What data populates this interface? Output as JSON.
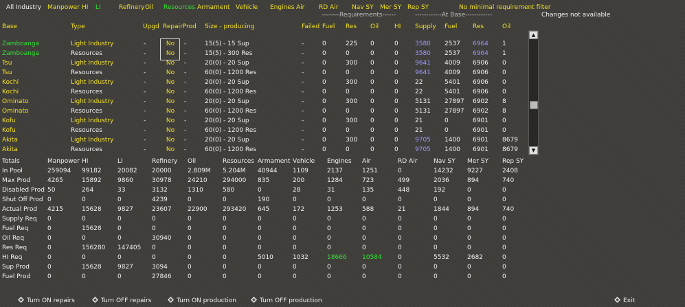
{
  "filters": [
    {
      "label": "All Industry",
      "color": "w"
    },
    {
      "label": "Manpower",
      "color": "y"
    },
    {
      "label": "HI",
      "color": "y"
    },
    {
      "label": "LI",
      "color": "g"
    },
    {
      "label": "Refinery",
      "color": "y"
    },
    {
      "label": "Oil",
      "color": "y"
    },
    {
      "label": "Resources",
      "color": "g"
    },
    {
      "label": "Armament",
      "color": "y"
    },
    {
      "label": "Vehicle",
      "color": "y"
    },
    {
      "label": "Engines",
      "color": "y"
    },
    {
      "label": "Air",
      "color": "y"
    },
    {
      "label": "RD Air",
      "color": "y"
    },
    {
      "label": "Nav SY",
      "color": "y"
    },
    {
      "label": "Mer SY",
      "color": "y"
    },
    {
      "label": "Rep SY",
      "color": "y"
    }
  ],
  "no_min_filter": "No minimal requirement filter",
  "requirements_label": "--------Requirements------",
  "at_base_label": "------------At Base------------",
  "changes_note": "Changes not available",
  "columns": [
    "Base",
    "Type",
    "Upgd",
    "RepairProd",
    "Size - producing",
    "Failed",
    "Fuel",
    "Res",
    "Oil",
    "HI",
    "Supply",
    "Fuel",
    "Res",
    "Oil"
  ],
  "rows": [
    {
      "base": "Zamboanga",
      "type": "Light Industry",
      "upgd": "-",
      "repair": "No",
      "size": "15(5) - 15 Sup",
      "failed": "-",
      "fuel": "0",
      "res": "225",
      "oil": "0",
      "hi": "0",
      "supply": "3580",
      "bfuel": "2537",
      "bres": "6964",
      "boil": "1",
      "bc": "g",
      "sc": "b",
      "rc": "b",
      "rowc": "y"
    },
    {
      "base": "Zamboanga",
      "type": "Resources",
      "upgd": "-",
      "repair": "No",
      "size": "15(5) - 300 Res",
      "failed": "-",
      "fuel": "0",
      "res": "0",
      "oil": "0",
      "hi": "0",
      "supply": "3580",
      "bfuel": "2537",
      "bres": "6964",
      "boil": "1",
      "bc": "g",
      "sc": "b",
      "rc": "b",
      "rowc": "w"
    },
    {
      "base": "Tsu",
      "type": "Light Industry",
      "upgd": "-",
      "repair": "No",
      "size": "20(0) - 20 Sup",
      "failed": "-",
      "fuel": "0",
      "res": "300",
      "oil": "0",
      "hi": "0",
      "supply": "9641",
      "bfuel": "4009",
      "bres": "6906",
      "boil": "0",
      "bc": "y",
      "sc": "b",
      "rc": "w",
      "rowc": "y"
    },
    {
      "base": "Tsu",
      "type": "Resources",
      "upgd": "-",
      "repair": "No",
      "size": "60(0) - 1200 Res",
      "failed": "-",
      "fuel": "0",
      "res": "0",
      "oil": "0",
      "hi": "0",
      "supply": "9641",
      "bfuel": "4009",
      "bres": "6906",
      "boil": "0",
      "bc": "y",
      "sc": "b",
      "rc": "w",
      "rowc": "w"
    },
    {
      "base": "Kochi",
      "type": "Light Industry",
      "upgd": "-",
      "repair": "No",
      "size": "20(0) - 20 Sup",
      "failed": "-",
      "fuel": "0",
      "res": "300",
      "oil": "0",
      "hi": "0",
      "supply": "22",
      "bfuel": "5401",
      "bres": "6906",
      "boil": "0",
      "bc": "y",
      "sc": "w",
      "rc": "w",
      "rowc": "y"
    },
    {
      "base": "Kochi",
      "type": "Resources",
      "upgd": "-",
      "repair": "No",
      "size": "60(0) - 1200 Res",
      "failed": "-",
      "fuel": "0",
      "res": "0",
      "oil": "0",
      "hi": "0",
      "supply": "22",
      "bfuel": "5401",
      "bres": "6906",
      "boil": "0",
      "bc": "y",
      "sc": "w",
      "rc": "w",
      "rowc": "w"
    },
    {
      "base": "Ominato",
      "type": "Light Industry",
      "upgd": "-",
      "repair": "No",
      "size": "20(0) - 20 Sup",
      "failed": "-",
      "fuel": "0",
      "res": "300",
      "oil": "0",
      "hi": "0",
      "supply": "5131",
      "bfuel": "27897",
      "bres": "6902",
      "boil": "8",
      "bc": "y",
      "sc": "w",
      "rc": "w",
      "rowc": "y"
    },
    {
      "base": "Ominato",
      "type": "Resources",
      "upgd": "-",
      "repair": "No",
      "size": "60(0) - 1200 Res",
      "failed": "-",
      "fuel": "0",
      "res": "0",
      "oil": "0",
      "hi": "0",
      "supply": "5131",
      "bfuel": "27897",
      "bres": "6902",
      "boil": "8",
      "bc": "y",
      "sc": "w",
      "rc": "w",
      "rowc": "w"
    },
    {
      "base": "Kofu",
      "type": "Light Industry",
      "upgd": "-",
      "repair": "No",
      "size": "20(0) - 20 Sup",
      "failed": "-",
      "fuel": "0",
      "res": "300",
      "oil": "0",
      "hi": "0",
      "supply": "21",
      "bfuel": "0",
      "bres": "6901",
      "boil": "0",
      "bc": "y",
      "sc": "w",
      "rc": "w",
      "rowc": "y"
    },
    {
      "base": "Kofu",
      "type": "Resources",
      "upgd": "-",
      "repair": "No",
      "size": "60(0) - 1200 Res",
      "failed": "-",
      "fuel": "0",
      "res": "0",
      "oil": "0",
      "hi": "0",
      "supply": "21",
      "bfuel": "0",
      "bres": "6901",
      "boil": "0",
      "bc": "y",
      "sc": "w",
      "rc": "w",
      "rowc": "w"
    },
    {
      "base": "Akita",
      "type": "Light Industry",
      "upgd": "-",
      "repair": "No",
      "size": "20(0) - 20 Sup",
      "failed": "-",
      "fuel": "0",
      "res": "300",
      "oil": "0",
      "hi": "0",
      "supply": "9705",
      "bfuel": "1400",
      "bres": "6901",
      "boil": "8679",
      "bc": "y",
      "sc": "b",
      "rc": "w",
      "rowc": "y"
    },
    {
      "base": "Akita",
      "type": "Resources",
      "upgd": "-",
      "repair": "No",
      "size": "60(0) - 1200 Res",
      "failed": "-",
      "fuel": "0",
      "res": "0",
      "oil": "0",
      "hi": "0",
      "supply": "9705",
      "bfuel": "1400",
      "bres": "6901",
      "boil": "8679",
      "bc": "y",
      "sc": "b",
      "rc": "w",
      "rowc": "w"
    }
  ],
  "totals_header": [
    "Totals",
    "Manpower",
    "HI",
    "LI",
    "Refinery",
    "Oil",
    "Resources",
    "Armament",
    "Vehicle",
    "Engines",
    "Air",
    "RD Air",
    "Nav SY",
    "Mer SY",
    "Rep SY"
  ],
  "totals": [
    {
      "label": "In Pool",
      "values": [
        "259094",
        "99182",
        "20082",
        "20000",
        "2.809M",
        "5.204M",
        "40944",
        "1109",
        "2137",
        "1251",
        "0",
        "14232",
        "9227",
        "2408"
      ]
    },
    {
      "label": "Max Prod",
      "values": [
        "4265",
        "15892",
        "9860",
        "30978",
        "24210",
        "294000",
        "835",
        "200",
        "1284",
        "723",
        "499",
        "2036",
        "894",
        "740"
      ]
    },
    {
      "label": "Disabled Prod",
      "values": [
        "50",
        "264",
        "33",
        "3132",
        "1310",
        "580",
        "0",
        "28",
        "31",
        "135",
        "448",
        "192",
        "0",
        "0"
      ]
    },
    {
      "label": "Shut Off Prod",
      "values": [
        "0",
        "0",
        "0",
        "4239",
        "0",
        "0",
        "190",
        "0",
        "0",
        "0",
        "0",
        "0",
        "0",
        "0"
      ]
    },
    {
      "label": "Actual Prod",
      "values": [
        "4215",
        "15628",
        "9827",
        "23607",
        "22900",
        "293420",
        "645",
        "172",
        "1253",
        "588",
        "21",
        "1844",
        "894",
        "740"
      ]
    },
    {
      "label": "Supply Req",
      "values": [
        "0",
        "0",
        "0",
        "0",
        "0",
        "0",
        "0",
        "0",
        "0",
        "0",
        "0",
        "0",
        "0",
        "0"
      ]
    },
    {
      "label": "Fuel Req",
      "values": [
        "0",
        "15628",
        "0",
        "0",
        "0",
        "0",
        "0",
        "0",
        "0",
        "0",
        "0",
        "0",
        "0",
        "0"
      ]
    },
    {
      "label": "Oil Req",
      "values": [
        "0",
        "0",
        "0",
        "30940",
        "0",
        "0",
        "0",
        "0",
        "0",
        "0",
        "0",
        "0",
        "0",
        "0"
      ]
    },
    {
      "label": "Res Req",
      "values": [
        "0",
        "156280",
        "147405",
        "0",
        "0",
        "0",
        "0",
        "0",
        "0",
        "0",
        "0",
        "0",
        "0",
        "0"
      ]
    },
    {
      "label": "HI Req",
      "values": [
        "0",
        "0",
        "0",
        "0",
        "0",
        "0",
        "5010",
        "1032",
        "18666",
        "10584",
        "0",
        "5532",
        "2682",
        "0"
      ]
    },
    {
      "label": "Sup Prod",
      "values": [
        "0",
        "15628",
        "9827",
        "3094",
        "0",
        "0",
        "0",
        "0",
        "0",
        "0",
        "0",
        "0",
        "0",
        "0"
      ]
    },
    {
      "label": "Fuel Prod",
      "values": [
        "0",
        "0",
        "0",
        "27846",
        "0",
        "0",
        "0",
        "0",
        "0",
        "0",
        "0",
        "0",
        "0",
        "0"
      ]
    }
  ],
  "green_cells": [
    [
      9,
      8
    ],
    [
      9,
      9
    ]
  ],
  "actions": {
    "turn_on_repairs": "Turn ON repairs",
    "turn_off_repairs": "Turn OFF repairs",
    "turn_on_production": "Turn ON production",
    "turn_off_production": "Turn OFF production",
    "exit": "Exit"
  },
  "scroll": {
    "up": "▲",
    "down": "▼"
  }
}
